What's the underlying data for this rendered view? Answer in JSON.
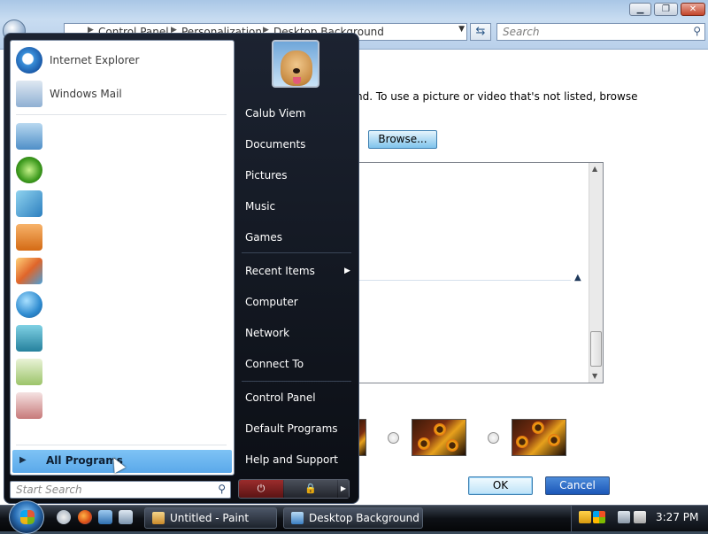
{
  "window": {
    "breadcrumb": [
      "Control Panel",
      "Personalization",
      "Desktop Background"
    ],
    "search_placeholder": "Search",
    "body_text": "nd. To use a picture or video that's not listed, browse",
    "browse_label": "Browse...",
    "ok_label": "OK",
    "cancel_label": "Cancel"
  },
  "start_menu": {
    "pinned": [
      {
        "label": "Internet Explorer",
        "icon": "internet-explorer-icon"
      },
      {
        "label": "Windows Mail",
        "icon": "windows-mail-icon"
      }
    ],
    "recent_programs_icons": [
      "calculator-icon",
      "windows-update-icon",
      "games-explorer-icon",
      "media-player-icon",
      "photo-gallery-icon",
      "contacts-icon",
      "media-center-icon",
      "sticky-notes-icon",
      "paint-icon"
    ],
    "all_programs": "All Programs",
    "search_placeholder": "Start Search",
    "right_links": [
      "Calub Viem",
      "Documents",
      "Pictures",
      "Music",
      "Games",
      "Recent Items",
      "Computer",
      "Network",
      "Connect To",
      "Control Panel",
      "Default Programs",
      "Help and Support"
    ]
  },
  "taskbar": {
    "tasks": [
      "Untitled - Paint",
      "Desktop Background"
    ],
    "clock": "3:27 PM"
  }
}
